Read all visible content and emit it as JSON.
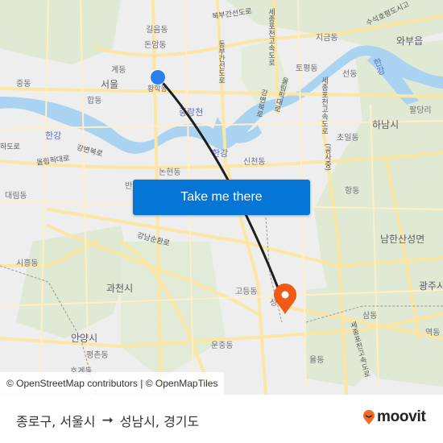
{
  "map": {
    "labels": {
      "seoul": "서울",
      "gileum": "길음동",
      "donam": "돈암동",
      "gye": "계동",
      "jung": "중동",
      "hap": "합동",
      "hwanghak": "황학동",
      "jungnangcheon": "중랑천",
      "hangang_w": "한강",
      "hangang_c": "한강",
      "hangang_e": "한강",
      "gangbyeonbuk": "강변북로",
      "olympic": "올림픽대로",
      "hado": "하도로",
      "daerim": "대림동",
      "nonhyeon": "논현동",
      "ban": "반",
      "sincheon": "신천동",
      "bukbu": "북부간선도로",
      "dongbu": "동부간선도로",
      "sejong1": "세종포천고속도로",
      "sejong2": "세종포천고속도로",
      "gangbyeon2": "강변북로",
      "olympic2": "올림픽대로",
      "jigeum": "지금동",
      "topyeong": "토평동",
      "waebu": "와부읍",
      "suseok": "수석호평도시고",
      "seon": "선동",
      "paldang": "팔당리",
      "hanam": "하남시",
      "choil": "초일동",
      "gongsa": "(공사중)",
      "hang": "항동",
      "namhansanseong": "남한산성면",
      "gwangju": "광주시",
      "sam": "삼동",
      "yeok": "역동",
      "yul": "율동",
      "sejong3": "세종포천고속도로",
      "gangnam_sunhwan": "강남순환로",
      "siheung": "시흥동",
      "gwacheon": "과천시",
      "anyang": "안양시",
      "pyeongchon": "평촌동",
      "hogye": "호계동",
      "godeung": "고등동",
      "unjung": "운중동",
      "seong": "성"
    },
    "colors": {
      "land": "#eeeeef",
      "green": "#dfe9d3",
      "water": "#aad3f2",
      "road": "#fbe7a3",
      "route": "#1f1f1f",
      "origin": "#2a7ef0",
      "destination": "#f05a14"
    },
    "origin_icon": "origin-dot-icon",
    "destination_icon": "destination-pin-icon"
  },
  "cta": {
    "label": "Take me there"
  },
  "attribution": "© OpenStreetMap contributors | © OpenMapTiles",
  "footer": {
    "origin": "종로구, 서울시",
    "arrow_icon": "arrow-right-icon",
    "destination": "성남시, 경기도",
    "brand": "moovit",
    "brand_color": "#f26b21"
  }
}
